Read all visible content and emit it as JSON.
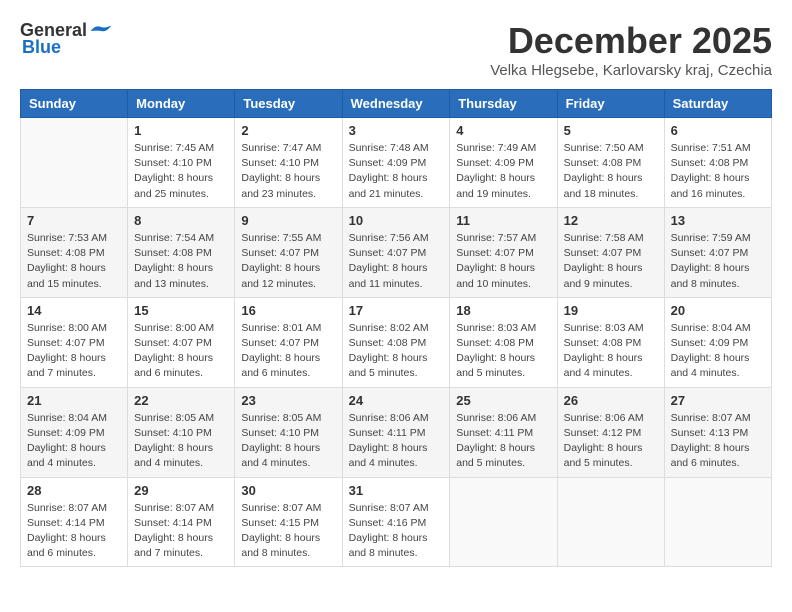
{
  "logo": {
    "general": "General",
    "blue": "Blue"
  },
  "title": "December 2025",
  "subtitle": "Velka Hlegsebe, Karlovarsky kraj, Czechia",
  "headers": [
    "Sunday",
    "Monday",
    "Tuesday",
    "Wednesday",
    "Thursday",
    "Friday",
    "Saturday"
  ],
  "weeks": [
    [
      {
        "day": "",
        "info": ""
      },
      {
        "day": "1",
        "info": "Sunrise: 7:45 AM\nSunset: 4:10 PM\nDaylight: 8 hours\nand 25 minutes."
      },
      {
        "day": "2",
        "info": "Sunrise: 7:47 AM\nSunset: 4:10 PM\nDaylight: 8 hours\nand 23 minutes."
      },
      {
        "day": "3",
        "info": "Sunrise: 7:48 AM\nSunset: 4:09 PM\nDaylight: 8 hours\nand 21 minutes."
      },
      {
        "day": "4",
        "info": "Sunrise: 7:49 AM\nSunset: 4:09 PM\nDaylight: 8 hours\nand 19 minutes."
      },
      {
        "day": "5",
        "info": "Sunrise: 7:50 AM\nSunset: 4:08 PM\nDaylight: 8 hours\nand 18 minutes."
      },
      {
        "day": "6",
        "info": "Sunrise: 7:51 AM\nSunset: 4:08 PM\nDaylight: 8 hours\nand 16 minutes."
      }
    ],
    [
      {
        "day": "7",
        "info": "Sunrise: 7:53 AM\nSunset: 4:08 PM\nDaylight: 8 hours\nand 15 minutes."
      },
      {
        "day": "8",
        "info": "Sunrise: 7:54 AM\nSunset: 4:08 PM\nDaylight: 8 hours\nand 13 minutes."
      },
      {
        "day": "9",
        "info": "Sunrise: 7:55 AM\nSunset: 4:07 PM\nDaylight: 8 hours\nand 12 minutes."
      },
      {
        "day": "10",
        "info": "Sunrise: 7:56 AM\nSunset: 4:07 PM\nDaylight: 8 hours\nand 11 minutes."
      },
      {
        "day": "11",
        "info": "Sunrise: 7:57 AM\nSunset: 4:07 PM\nDaylight: 8 hours\nand 10 minutes."
      },
      {
        "day": "12",
        "info": "Sunrise: 7:58 AM\nSunset: 4:07 PM\nDaylight: 8 hours\nand 9 minutes."
      },
      {
        "day": "13",
        "info": "Sunrise: 7:59 AM\nSunset: 4:07 PM\nDaylight: 8 hours\nand 8 minutes."
      }
    ],
    [
      {
        "day": "14",
        "info": "Sunrise: 8:00 AM\nSunset: 4:07 PM\nDaylight: 8 hours\nand 7 minutes."
      },
      {
        "day": "15",
        "info": "Sunrise: 8:00 AM\nSunset: 4:07 PM\nDaylight: 8 hours\nand 6 minutes."
      },
      {
        "day": "16",
        "info": "Sunrise: 8:01 AM\nSunset: 4:07 PM\nDaylight: 8 hours\nand 6 minutes."
      },
      {
        "day": "17",
        "info": "Sunrise: 8:02 AM\nSunset: 4:08 PM\nDaylight: 8 hours\nand 5 minutes."
      },
      {
        "day": "18",
        "info": "Sunrise: 8:03 AM\nSunset: 4:08 PM\nDaylight: 8 hours\nand 5 minutes."
      },
      {
        "day": "19",
        "info": "Sunrise: 8:03 AM\nSunset: 4:08 PM\nDaylight: 8 hours\nand 4 minutes."
      },
      {
        "day": "20",
        "info": "Sunrise: 8:04 AM\nSunset: 4:09 PM\nDaylight: 8 hours\nand 4 minutes."
      }
    ],
    [
      {
        "day": "21",
        "info": "Sunrise: 8:04 AM\nSunset: 4:09 PM\nDaylight: 8 hours\nand 4 minutes."
      },
      {
        "day": "22",
        "info": "Sunrise: 8:05 AM\nSunset: 4:10 PM\nDaylight: 8 hours\nand 4 minutes."
      },
      {
        "day": "23",
        "info": "Sunrise: 8:05 AM\nSunset: 4:10 PM\nDaylight: 8 hours\nand 4 minutes."
      },
      {
        "day": "24",
        "info": "Sunrise: 8:06 AM\nSunset: 4:11 PM\nDaylight: 8 hours\nand 4 minutes."
      },
      {
        "day": "25",
        "info": "Sunrise: 8:06 AM\nSunset: 4:11 PM\nDaylight: 8 hours\nand 5 minutes."
      },
      {
        "day": "26",
        "info": "Sunrise: 8:06 AM\nSunset: 4:12 PM\nDaylight: 8 hours\nand 5 minutes."
      },
      {
        "day": "27",
        "info": "Sunrise: 8:07 AM\nSunset: 4:13 PM\nDaylight: 8 hours\nand 6 minutes."
      }
    ],
    [
      {
        "day": "28",
        "info": "Sunrise: 8:07 AM\nSunset: 4:14 PM\nDaylight: 8 hours\nand 6 minutes."
      },
      {
        "day": "29",
        "info": "Sunrise: 8:07 AM\nSunset: 4:14 PM\nDaylight: 8 hours\nand 7 minutes."
      },
      {
        "day": "30",
        "info": "Sunrise: 8:07 AM\nSunset: 4:15 PM\nDaylight: 8 hours\nand 8 minutes."
      },
      {
        "day": "31",
        "info": "Sunrise: 8:07 AM\nSunset: 4:16 PM\nDaylight: 8 hours\nand 8 minutes."
      },
      {
        "day": "",
        "info": ""
      },
      {
        "day": "",
        "info": ""
      },
      {
        "day": "",
        "info": ""
      }
    ]
  ]
}
